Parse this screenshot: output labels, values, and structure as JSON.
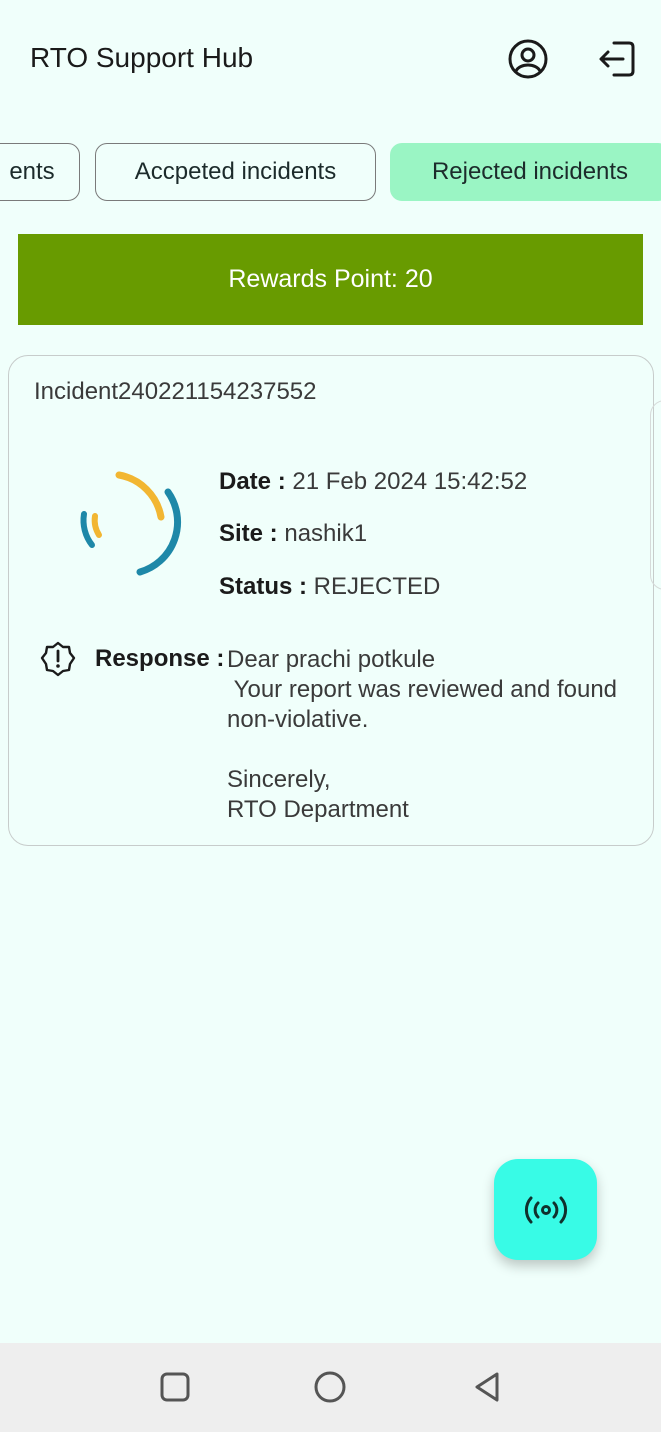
{
  "header": {
    "title": "RTO Support Hub",
    "profile_icon": "account-circle-icon",
    "logout_icon": "logout-icon"
  },
  "tabs": [
    {
      "label": "ents",
      "selected": false
    },
    {
      "label": "Accpeted incidents",
      "selected": false
    },
    {
      "label": "Rejected incidents",
      "selected": true
    }
  ],
  "rewards": {
    "text": "Rewards Point: 20",
    "color": "#689b00"
  },
  "incident": {
    "id": "Incident240221154237552",
    "date_label": "Date :",
    "date_value": " 21 Feb 2024 15:42:52",
    "site_label": "Site :",
    "site_value": " nashik1",
    "status_label": "Status :",
    "status_value": " REJECTED",
    "response_label": "Response :",
    "response_lines": [
      "Dear prachi potkule",
      " Your report was reviewed and found non-violative.",
      "",
      "Sincerely,",
      "RTO Department"
    ]
  },
  "fab": {
    "icon": "broadcast-signal-icon",
    "color": "#38fbe6"
  },
  "colors": {
    "background": "#f0fffb",
    "selected_tab": "#9af5c4",
    "loader_blue": "#1e88a8",
    "loader_yellow": "#f2b632"
  },
  "navbar": {
    "icons": [
      "recents-icon",
      "home-icon",
      "back-icon"
    ]
  }
}
